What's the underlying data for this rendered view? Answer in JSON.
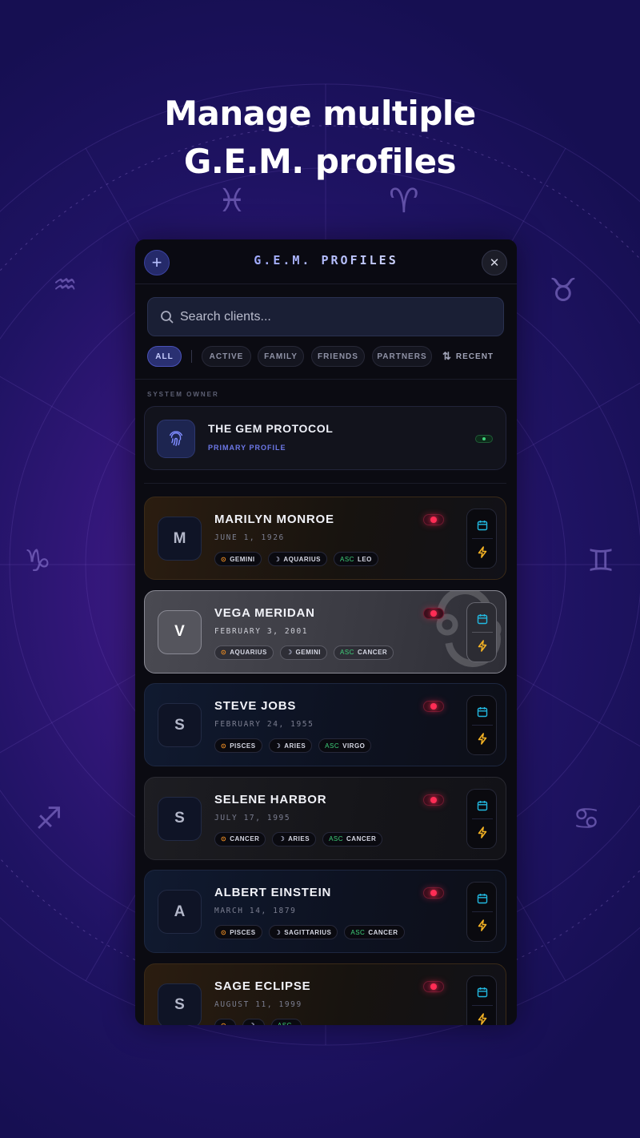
{
  "headline": {
    "line1": "Manage multiple",
    "line2": "G.E.M. profiles"
  },
  "app": {
    "title": "G.E.M. PROFILES",
    "add_icon": "plus-icon",
    "close_icon": "close-icon"
  },
  "search": {
    "placeholder": "Search clients...",
    "value": ""
  },
  "filters": {
    "chips": [
      "ALL",
      "ACTIVE",
      "FAMILY",
      "FRIENDS",
      "PARTNERS"
    ],
    "active": "ALL",
    "sort_label": "RECENT",
    "sort_icon": "sort-arrows-icon"
  },
  "owner_section": {
    "label": "SYSTEM OWNER",
    "name": "THE GEM PROTOCOL",
    "subtitle": "PRIMARY PROFILE",
    "icon": "fingerprint-icon"
  },
  "profiles": [
    {
      "initial": "M",
      "name": "MARILYN MONROE",
      "date": "JUNE 1, 1926",
      "sun": "GEMINI",
      "moon": "AQUARIUS",
      "asc_label": "ASC",
      "asc": "LEO",
      "theme": "amber"
    },
    {
      "initial": "V",
      "name": "VEGA MERIDAN",
      "date": "FEBRUARY 3, 2001",
      "sun": "AQUARIUS",
      "moon": "GEMINI",
      "asc_label": "ASC",
      "asc": "CANCER",
      "theme": "silver"
    },
    {
      "initial": "S",
      "name": "STEVE JOBS",
      "date": "FEBRUARY 24, 1955",
      "sun": "PISCES",
      "moon": "ARIES",
      "asc_label": "ASC",
      "asc": "VIRGO",
      "theme": "navy"
    },
    {
      "initial": "S",
      "name": "SELENE HARBOR",
      "date": "JULY 17, 1995",
      "sun": "CANCER",
      "moon": "ARIES",
      "asc_label": "ASC",
      "asc": "CANCER",
      "theme": "dark"
    },
    {
      "initial": "A",
      "name": "ALBERT EINSTEIN",
      "date": "MARCH 14, 1879",
      "sun": "PISCES",
      "moon": "SAGITTARIUS",
      "asc_label": "ASC",
      "asc": "CANCER",
      "theme": "navy"
    },
    {
      "initial": "S",
      "name": "SAGE ECLIPSE",
      "date": "AUGUST 11, 1999",
      "sun": "",
      "moon": "",
      "asc_label": "ASC",
      "asc": "",
      "theme": "amber"
    }
  ],
  "icons": {
    "sun_symbol": "⊙",
    "moon_symbol": "☽",
    "calendar": "calendar-icon",
    "bolt": "lightning-bolt-icon",
    "status": "status-toggle"
  },
  "colors": {
    "accent": "#6d78e8",
    "status_active": "#ff2d55",
    "asc_green": "#3fd17a",
    "sun_orange": "#e88a22",
    "calendar_cyan": "#22b8e0",
    "bolt_yellow": "#f5b324"
  },
  "zodiac_glyphs": [
    "♓",
    "♈",
    "♒",
    "♉",
    "♑",
    "♊",
    "♐",
    "♋"
  ]
}
